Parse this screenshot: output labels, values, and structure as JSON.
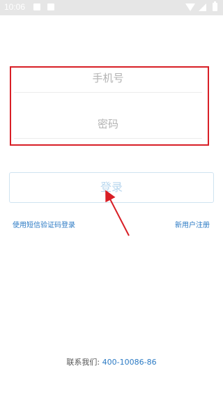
{
  "status_bar": {
    "time": "10:06",
    "icons": [
      "gallery-icon",
      "notification-icon",
      "wifi-icon",
      "signal-icon",
      "battery-icon"
    ]
  },
  "form": {
    "phone_placeholder": "手机号",
    "password_placeholder": "密码",
    "highlight_color": "#d81f26"
  },
  "login_button": {
    "label": "登录"
  },
  "links": {
    "sms_login": "使用短信验证码登录",
    "register": "新用户注册"
  },
  "contact": {
    "label": "联系我们:",
    "phone": "400-10086-86"
  },
  "colors": {
    "link": "#2b7ac4",
    "status_bar": "#e6e6e6",
    "placeholder": "#b3b3b3"
  }
}
